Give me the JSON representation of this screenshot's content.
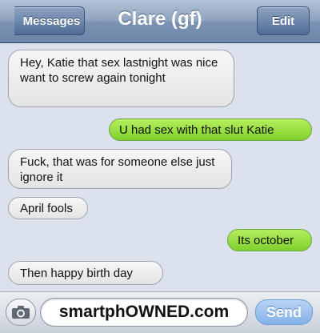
{
  "navbar": {
    "back_label": "Messages",
    "title": "Clare (gf)",
    "edit_label": "Edit"
  },
  "messages": [
    {
      "direction": "incoming",
      "text": "Hey, Katie that sex lastnight was nice want to screw again tonight"
    },
    {
      "direction": "outgoing",
      "text": "U had sex with that slut Katie"
    },
    {
      "direction": "incoming",
      "text": "Fuck, that was for someone else just ignore it"
    },
    {
      "direction": "incoming",
      "text": "April fools"
    },
    {
      "direction": "outgoing",
      "text": "Its october"
    },
    {
      "direction": "incoming",
      "text": "Then happy birth day"
    }
  ],
  "composer": {
    "camera_icon": "camera-icon",
    "input_value": "smartphOWNED.com",
    "send_label": "Send"
  },
  "colors": {
    "navbar": "#7b92b3",
    "outgoing_bubble": "#8fd83a",
    "incoming_bubble": "#ececec",
    "background": "#dbe2ed",
    "send_button": "#84b1e9"
  }
}
